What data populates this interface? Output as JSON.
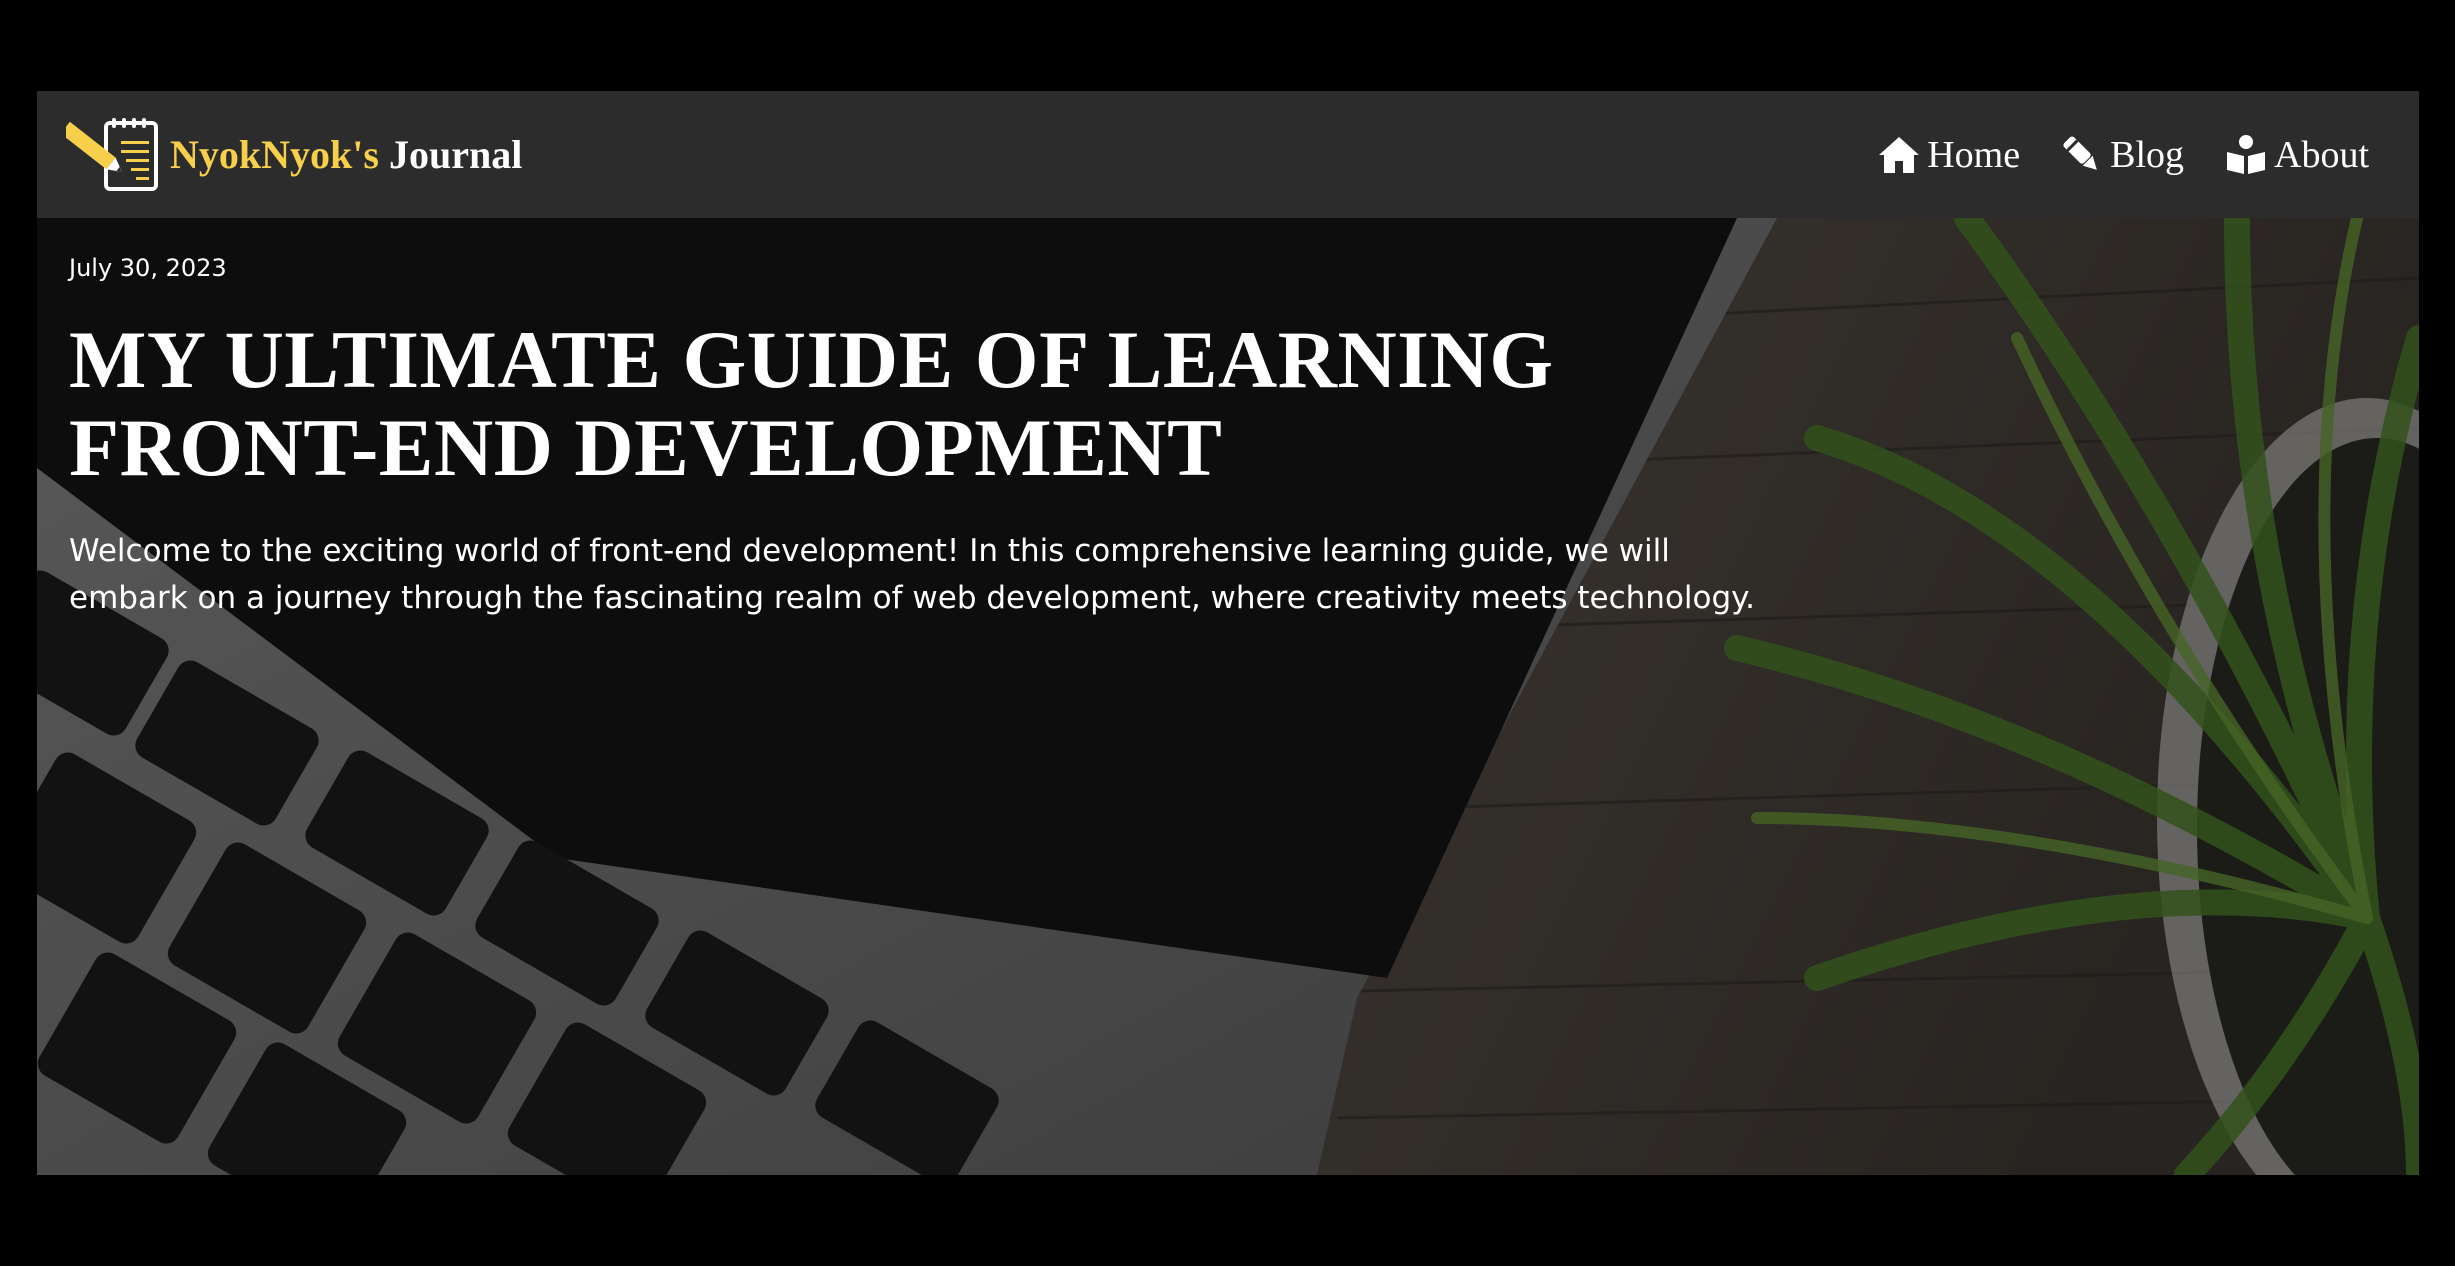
{
  "brand": {
    "name_first": "NyokNyok's",
    "name_second": "Journal",
    "logo_icon": "notepad-pencil-icon",
    "accent_color": "#f7cf4b"
  },
  "nav": {
    "items": [
      {
        "label": "Home",
        "icon": "home-icon"
      },
      {
        "label": "Blog",
        "icon": "pen-icon"
      },
      {
        "label": "About",
        "icon": "book-reader-icon"
      }
    ]
  },
  "hero": {
    "date": "July 30, 2023",
    "title": "MY ULTIMATE GUIDE OF LEARNING FRONT-END DEVELOPMENT",
    "intro": "Welcome to the exciting world of front-end development! In this comprehensive learning guide, we will embark on a journey through the fascinating realm of web development, where creativity meets technology."
  }
}
